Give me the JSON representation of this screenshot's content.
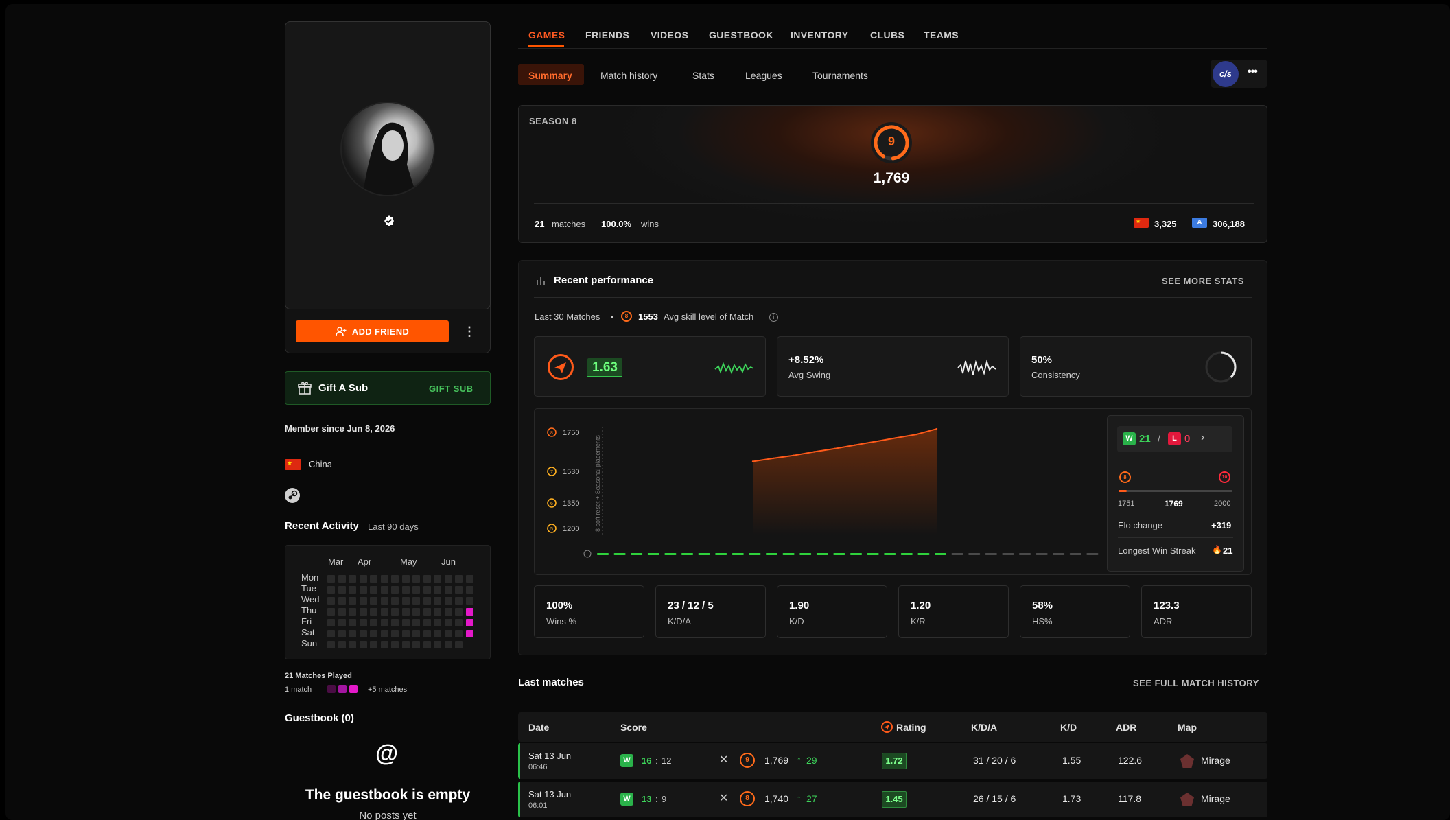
{
  "nav_tabs": [
    "GAMES",
    "FRIENDS",
    "VIDEOS",
    "GUESTBOOK",
    "INVENTORY",
    "CLUBS",
    "TEAMS"
  ],
  "sub_tabs": [
    "Summary",
    "Match history",
    "Stats",
    "Leagues",
    "Tournaments"
  ],
  "game_icon": "cs2-icon",
  "profile": {
    "add_friend": "ADD FRIEND",
    "gift_title": "Gift A Sub",
    "gift_button": "GIFT SUB",
    "member_since": "Member since Jun 8, 2026",
    "country": "China",
    "recent_activity": "Recent Activity",
    "recent_activity_range": "Last 90 days",
    "months": [
      "Mar",
      "Apr",
      "May",
      "Jun"
    ],
    "days": [
      "Mon",
      "Tue",
      "Wed",
      "Thu",
      "Fri",
      "Sat",
      "Sun"
    ],
    "matches_played": "21 Matches Played",
    "legend_min": "1 match",
    "legend_max": "+5 matches",
    "guestbook_title": "Guestbook (0)",
    "guestbook_empty": "The guestbook is empty",
    "guestbook_sub": "No posts yet"
  },
  "season": {
    "label": "SEASON 8",
    "level": "9",
    "elo": "1,769",
    "matches_num": "21",
    "matches_label": "matches",
    "wins_pct": "100.0%",
    "wins_label": "wins",
    "country_rank": "3,325",
    "region_rank": "306,188"
  },
  "performance": {
    "title": "Recent performance",
    "see_more": "SEE MORE STATS",
    "last_matches": "Last 30 Matches",
    "avg_skill": "1553",
    "avg_skill_label": "Avg skill level of Match",
    "rating": "1.63",
    "avg_swing": "+8.52%",
    "avg_swing_label": "Avg Swing",
    "consistency": "50%",
    "consistency_label": "Consistency",
    "consistency_value": 0.5
  },
  "chart_data": {
    "type": "area",
    "y_ticks": [
      "1750",
      "1530",
      "1350",
      "1200"
    ],
    "annotation": "8 soft reset + Seasonal placements",
    "series": [
      {
        "values": [
          1586,
          1604,
          1620,
          1640,
          1658,
          1678,
          1698,
          1718,
          1738,
          1769
        ]
      }
    ],
    "match_bars": {
      "won": 21,
      "pending": 9
    }
  },
  "side": {
    "wins": "21",
    "losses": "0",
    "min": "1751",
    "current": "1769",
    "max": "2000",
    "elo_change_label": "Elo change",
    "elo_change": "+319",
    "streak_label": "Longest Win Streak",
    "streak": "21"
  },
  "mini_stats": [
    {
      "v": "100%",
      "l": "Wins %"
    },
    {
      "v": "23 / 12 / 5",
      "l": "K/D/A"
    },
    {
      "v": "1.90",
      "l": "K/D"
    },
    {
      "v": "1.20",
      "l": "K/R"
    },
    {
      "v": "58%",
      "l": "HS%"
    },
    {
      "v": "123.3",
      "l": "ADR"
    }
  ],
  "last_matches": {
    "title": "Last matches",
    "see_full": "SEE FULL MATCH HISTORY",
    "headers": [
      "Date",
      "Score",
      "Rating",
      "K/D/A",
      "K/D",
      "ADR",
      "Map"
    ],
    "rows": [
      {
        "date": "Sat 13 Jun",
        "time": "06:46",
        "result": "W",
        "score_a": "16",
        "score_b": "12",
        "level": "9",
        "elo": "1,769",
        "elo_diff": "29",
        "rating": "1.72",
        "kda": "31 / 20 / 6",
        "kd": "1.55",
        "adr": "122.6",
        "map": "Mirage"
      },
      {
        "date": "Sat 13 Jun",
        "time": "06:01",
        "result": "W",
        "score_a": "13",
        "score_b": "9",
        "level": "8",
        "elo": "1,740",
        "elo_diff": "27",
        "rating": "1.45",
        "kda": "26 / 15 / 6",
        "kd": "1.73",
        "adr": "117.8",
        "map": "Mirage"
      }
    ]
  },
  "colors": {
    "accent": "#ff5500",
    "win": "#2ab24a",
    "loss": "#e3183c",
    "heat": "#e419c9"
  }
}
